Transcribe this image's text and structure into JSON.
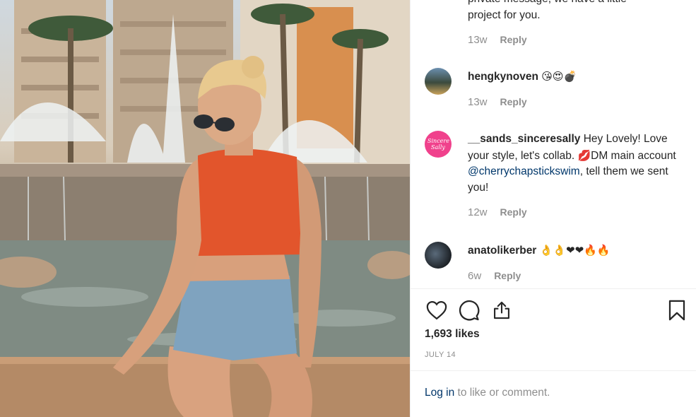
{
  "comments": [
    {
      "text_partial_line1": "private message, we have a little",
      "text_partial_line2": "project for you.",
      "time": "13w",
      "reply": "Reply"
    },
    {
      "username": "hengkynoven",
      "text": "😘😍💣",
      "time": "13w",
      "reply": "Reply"
    },
    {
      "username": "__sands_sinceresally",
      "text_a": " Hey Lovely! Love your style, let's collab. ",
      "heart": "💋",
      "text_b": "DM main account ",
      "mention": "@cherrychapstickswim",
      "text_c": ", tell them we sent you!",
      "avatar_text": "Sincere Sally",
      "time": "12w",
      "reply": "Reply"
    },
    {
      "username": "anatolikerber",
      "text": "👌👌❤❤🔥🔥",
      "time": "6w",
      "reply": "Reply"
    }
  ],
  "likes": "1,693 likes",
  "date": "JULY 14",
  "login": {
    "link": "Log in",
    "rest": " to like or comment."
  },
  "colors": {
    "accent": "#003569",
    "muted": "#8e8e8e",
    "avatar_pink": "#f0418c"
  },
  "icons": [
    "heart-icon",
    "comment-icon",
    "share-icon",
    "bookmark-icon"
  ]
}
